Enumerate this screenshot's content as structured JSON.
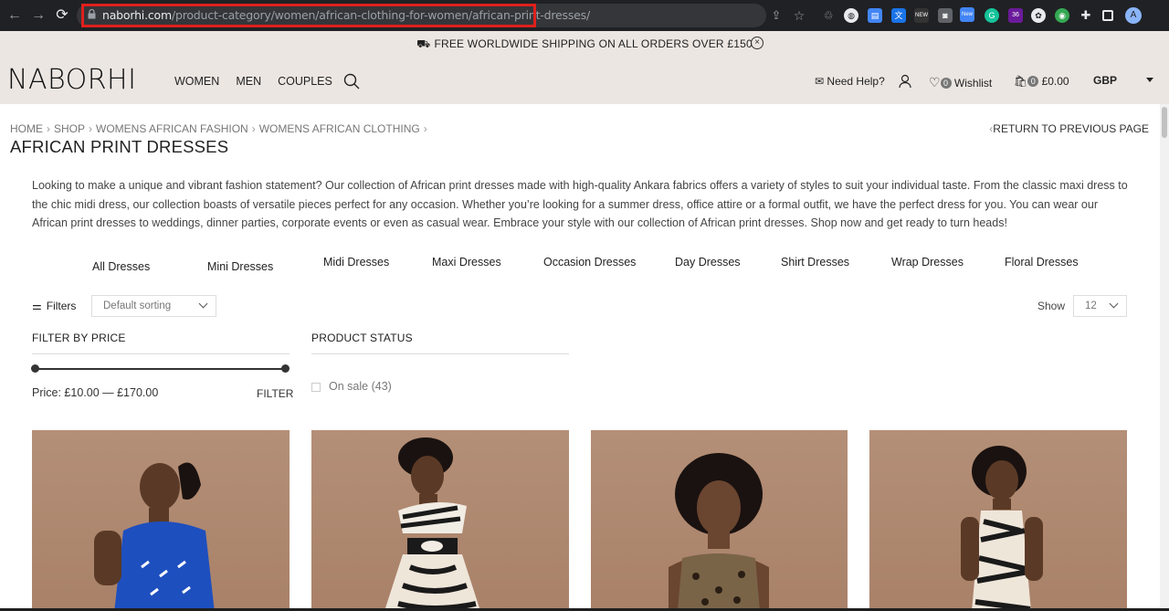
{
  "browser": {
    "url_host": "naborhi.com",
    "url_path": "/product-category/women/african-clothing-for-women/african-print-dresses/",
    "profile_initial": "A",
    "extension_badges": [
      "New",
      "36"
    ]
  },
  "announcement": {
    "text": "FREE WORLDWIDE SHIPPING ON ALL ORDERS OVER £150",
    "close_symbol": "×"
  },
  "header": {
    "logo": "NABORHI",
    "nav": [
      "WOMEN",
      "MEN",
      "COUPLES"
    ],
    "help_label": "Need Help?",
    "wishlist_count": "0",
    "wishlist_label": "Wishlist",
    "cart_count": "0",
    "cart_total": "£0.00",
    "currency": "GBP"
  },
  "breadcrumb": {
    "items": [
      "HOME",
      "SHOP",
      "WOMENS AFRICAN FASHION",
      "WOMENS AFRICAN CLOTHING"
    ],
    "separator": "›",
    "return_label": "RETURN TO PREVIOUS PAGE"
  },
  "page": {
    "title": "AFRICAN PRINT DRESSES",
    "description": "Looking to make a unique and vibrant fashion statement? Our collection of African print dresses made with high-quality Ankara fabrics offers a variety of styles to suit your individual taste. From the classic maxi dress to the chic midi dress, our collection boasts of versatile pieces perfect for any occasion. Whether you’re looking for a summer dress, office attire or a formal outfit, we have the perfect dress for you. You can wear our African print dresses to weddings, dinner parties, corporate events or even as casual wear. Embrace your style with our collection of African print dresses. Shop now and get ready to turn heads!"
  },
  "subcategories": [
    "All Dresses",
    "Mini Dresses",
    "Midi Dresses",
    "Maxi Dresses",
    "Occasion Dresses",
    "Day Dresses",
    "Shirt Dresses",
    "Wrap Dresses",
    "Floral Dresses"
  ],
  "toolbar": {
    "filters_label": "Filters",
    "sort_value": "Default sorting",
    "show_label": "Show",
    "show_value": "12"
  },
  "filter_price": {
    "title": "FILTER BY PRICE",
    "price_text": "Price: £10.00 — £170.00",
    "button_label": "FILTER"
  },
  "filter_status": {
    "title": "PRODUCT STATUS",
    "option_label": "On sale",
    "option_count": "(43)"
  },
  "colors": {
    "header_bg": "#ece6e2",
    "product_bg": "#b08b73",
    "url_highlight": "#e0201c"
  }
}
